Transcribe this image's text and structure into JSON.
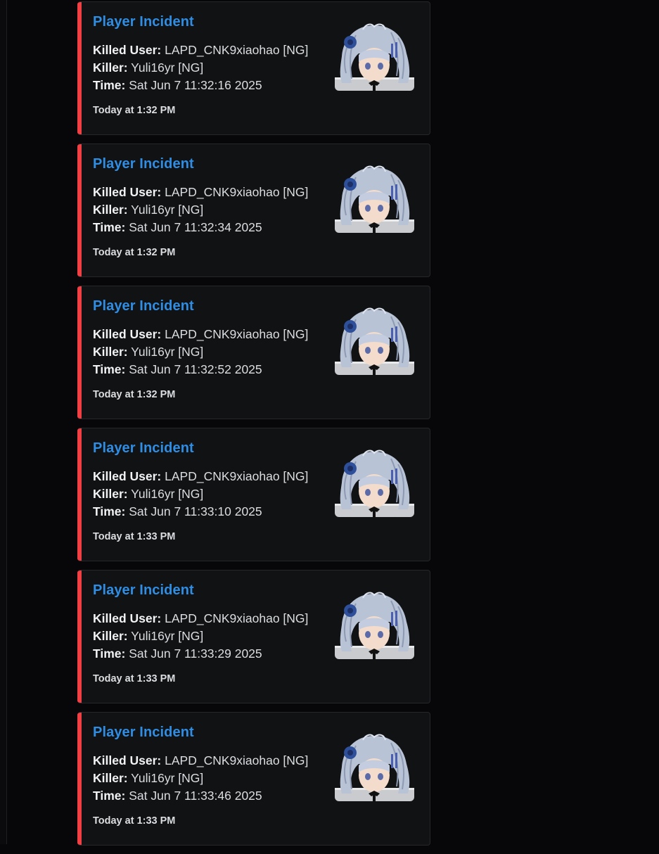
{
  "feed": {
    "embeds": [
      {
        "title": "Player Incident",
        "killed_user_label": "Killed User:",
        "killed_user_value": "LAPD_CNK9xiaohao [NG]",
        "killer_label": "Killer:",
        "killer_value": "Yuli16yr [NG]",
        "time_label": "Time:",
        "time_value": "Sat Jun 7 11:32:16 2025",
        "footer": "Today at 1:32 PM"
      },
      {
        "title": "Player Incident",
        "killed_user_label": "Killed User:",
        "killed_user_value": "LAPD_CNK9xiaohao [NG]",
        "killer_label": "Killer:",
        "killer_value": "Yuli16yr [NG]",
        "time_label": "Time:",
        "time_value": "Sat Jun 7 11:32:34 2025",
        "footer": "Today at 1:32 PM"
      },
      {
        "title": "Player Incident",
        "killed_user_label": "Killed User:",
        "killed_user_value": "LAPD_CNK9xiaohao [NG]",
        "killer_label": "Killer:",
        "killer_value": "Yuli16yr [NG]",
        "time_label": "Time:",
        "time_value": "Sat Jun 7 11:32:52 2025",
        "footer": "Today at 1:32 PM"
      },
      {
        "title": "Player Incident",
        "killed_user_label": "Killed User:",
        "killed_user_value": "LAPD_CNK9xiaohao [NG]",
        "killer_label": "Killer:",
        "killer_value": "Yuli16yr [NG]",
        "time_label": "Time:",
        "time_value": "Sat Jun 7 11:33:10 2025",
        "footer": "Today at 1:33 PM"
      },
      {
        "title": "Player Incident",
        "killed_user_label": "Killed User:",
        "killed_user_value": "LAPD_CNK9xiaohao [NG]",
        "killer_label": "Killer:",
        "killer_value": "Yuli16yr [NG]",
        "time_label": "Time:",
        "time_value": "Sat Jun 7 11:33:29 2025",
        "footer": "Today at 1:33 PM"
      },
      {
        "title": "Player Incident",
        "killed_user_label": "Killed User:",
        "killed_user_value": "LAPD_CNK9xiaohao [NG]",
        "killer_label": "Killer:",
        "killer_value": "Yuli16yr [NG]",
        "time_label": "Time:",
        "time_value": "Sat Jun 7 11:33:46 2025",
        "footer": "Today at 1:33 PM"
      }
    ]
  },
  "colors": {
    "accent_bar": "#f23f43",
    "title_link": "#2f8de4",
    "embed_bg": "#111214",
    "page_bg": "#070709"
  },
  "icons": {
    "thumbnail": "avatar-thumbnail-icon"
  }
}
